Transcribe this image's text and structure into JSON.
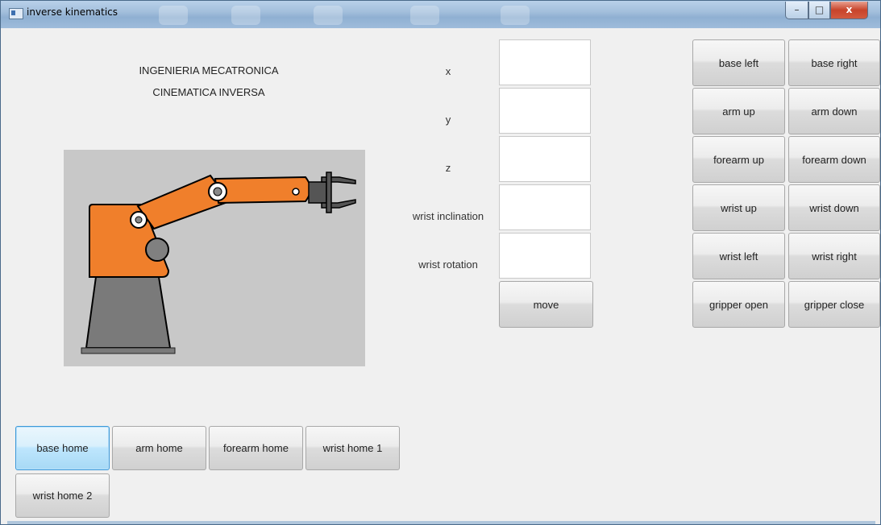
{
  "window": {
    "title": "inverse kinematics",
    "controls": {
      "minimize": "–",
      "maximize": "□",
      "close": "x"
    }
  },
  "header": {
    "line1": "INGENIERIA MECATRONICA",
    "line2": "CINEMATICA INVERSA"
  },
  "robot_colors": {
    "arm": "#f07f2b",
    "base": "#7a7a7a",
    "panel": "#c8c8c8",
    "joint": "#808080"
  },
  "inputs": {
    "x_label": "x",
    "y_label": "y",
    "z_label": "z",
    "wrist_inclination_label": "wrist inclination",
    "wrist_rotation_label": "wrist rotation",
    "x_value": "",
    "y_value": "",
    "z_value": "",
    "wrist_inclination_value": "",
    "wrist_rotation_value": ""
  },
  "move_button": "move",
  "jog": [
    {
      "left": "base left",
      "right": "base right"
    },
    {
      "left": "arm up",
      "right": "arm down"
    },
    {
      "left": "forearm up",
      "right": "forearm down"
    },
    {
      "left": "wrist up",
      "right": "wrist down"
    },
    {
      "left": "wrist left",
      "right": "wrist right"
    },
    {
      "left": "gripper open",
      "right": "gripper close"
    }
  ],
  "home_buttons": [
    "base home",
    "arm home",
    "forearm home",
    "wrist home 1",
    "wrist home 2"
  ]
}
